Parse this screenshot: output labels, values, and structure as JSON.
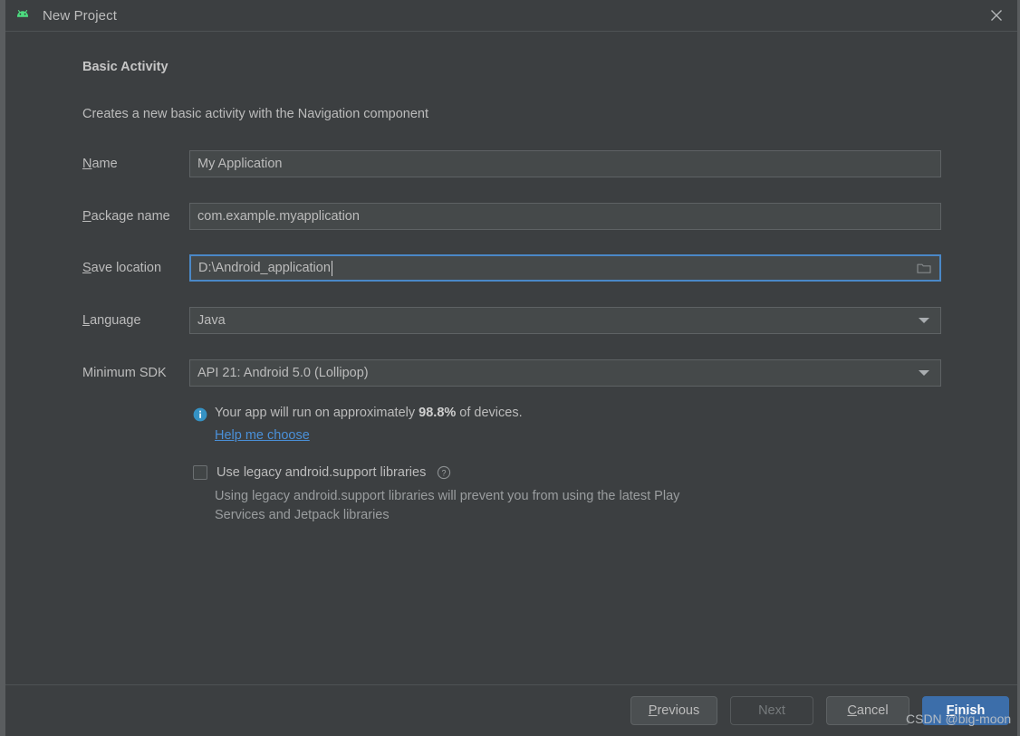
{
  "window": {
    "title": "New Project",
    "app_icon": "android-robot-icon",
    "close_icon": "close-icon"
  },
  "main": {
    "section_title": "Basic Activity",
    "section_description": "Creates a new basic activity with the Navigation component",
    "fields": [
      {
        "id": "name",
        "label_prefix": "",
        "label_mnemonic": "N",
        "label_suffix": "ame",
        "value": "My Application",
        "type": "text"
      },
      {
        "id": "package-name",
        "label_prefix": "",
        "label_mnemonic": "P",
        "label_suffix": "ackage name",
        "value": "com.example.myapplication",
        "type": "text"
      },
      {
        "id": "save-location",
        "label_prefix": "",
        "label_mnemonic": "S",
        "label_suffix": "ave location",
        "value": "D:\\Android_application",
        "type": "text-with-browse",
        "focused": true,
        "browse_icon": "folder-icon"
      },
      {
        "id": "language",
        "label_prefix": "",
        "label_mnemonic": "L",
        "label_suffix": "anguage",
        "value": "Java",
        "type": "dropdown",
        "dropdown_icon": "chevron-down-icon"
      },
      {
        "id": "minimum-sdk",
        "label_prefix": "Minimum SDK",
        "label_mnemonic": "",
        "label_suffix": "",
        "value": "API 21: Android 5.0 (Lollipop)",
        "type": "dropdown",
        "dropdown_icon": "chevron-down-icon"
      }
    ],
    "info": {
      "icon": "info-icon",
      "text_before": "Your app will run on approximately ",
      "percent": "98.8%",
      "text_after": " of devices.",
      "link_label": "Help me choose",
      "link_color": "#4a90d9"
    },
    "legacy_option": {
      "checked": false,
      "label": "Use legacy android.support libraries",
      "help_icon": "question-mark-icon",
      "description": "Using legacy android.support libraries will prevent you from using the latest Play Services and Jetpack libraries"
    }
  },
  "footer": {
    "buttons": [
      {
        "id": "previous",
        "mnemonic": "P",
        "rest": "revious",
        "disabled": false,
        "primary": false
      },
      {
        "id": "next",
        "mnemonic": "",
        "rest": "Next",
        "disabled": true,
        "primary": false
      },
      {
        "id": "cancel",
        "mnemonic": "C",
        "rest": "ancel",
        "disabled": false,
        "primary": false
      },
      {
        "id": "finish",
        "mnemonic": "F",
        "rest": "inish",
        "disabled": false,
        "primary": true
      }
    ]
  },
  "watermark": "CSDN @big-moon",
  "colors": {
    "dialog_background": "#3c3f41",
    "field_background": "#45494a",
    "field_border": "#5e6264",
    "focus_border": "#4a88c7",
    "primary_button": "#3c6eaa",
    "link": "#4a90d9",
    "android_green": "#4ddb7f",
    "info_blue": "#3592c4",
    "text": "#bcbcbc"
  }
}
